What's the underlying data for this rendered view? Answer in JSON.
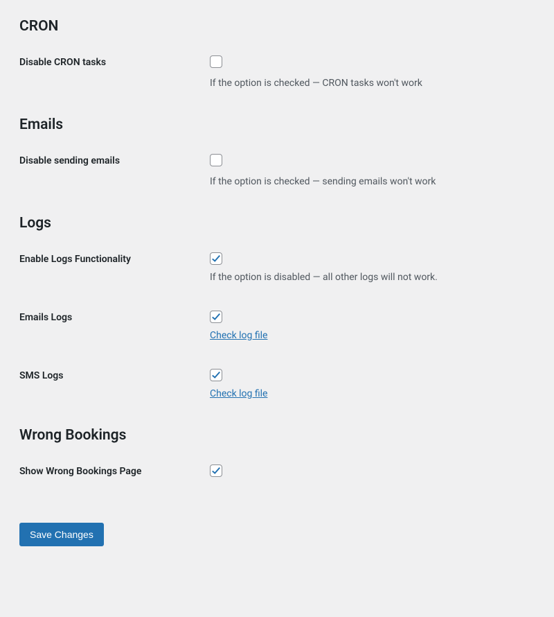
{
  "sections": {
    "cron": {
      "heading": "CRON",
      "rows": {
        "disable_cron": {
          "label": "Disable CRON tasks",
          "checked": false,
          "description": "If the option is checked — CRON tasks won't work"
        }
      }
    },
    "emails": {
      "heading": "Emails",
      "rows": {
        "disable_emails": {
          "label": "Disable sending emails",
          "checked": false,
          "description": "If the option is checked — sending emails won't work"
        }
      }
    },
    "logs": {
      "heading": "Logs",
      "rows": {
        "enable_logs": {
          "label": "Enable Logs Functionality",
          "checked": true,
          "description": "If the option is disabled — all other logs will not work."
        },
        "emails_logs": {
          "label": "Emails Logs",
          "checked": true,
          "link": "Check log file"
        },
        "sms_logs": {
          "label": "SMS Logs",
          "checked": true,
          "link": "Check log file"
        }
      }
    },
    "wrong_bookings": {
      "heading": "Wrong Bookings",
      "rows": {
        "show_wrong_bookings": {
          "label": "Show Wrong Bookings Page",
          "checked": true
        }
      }
    }
  },
  "save_button": "Save Changes"
}
